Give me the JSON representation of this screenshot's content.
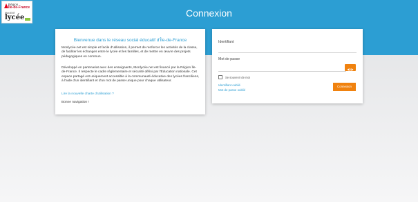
{
  "header": {
    "title": "Connexion",
    "background_color": "#2c9ed3"
  },
  "logo": {
    "line1": "Région",
    "line2": "Île-de-France",
    "line3": "Mon ENT",
    "line4": "lycée"
  },
  "info_card": {
    "welcome": "Bienvenue dans le réseau social éducatif d'Île-de-France",
    "paragraph1": "Monlycée.net est simple et facile d'utilisation, il permet de renforcer les activités de la classe, de faciliter les échanges entre le lycée et les familles, et de mettre en œuvre des projets pédagogiques en commun.",
    "paragraph2": "Développé en partenariat avec des enseignants, Monlycée.net est financé par la Région Île-de-France. Il respecte le cadre réglementaire et sécurité défini par l'Éducation nationale. Cet espace partagé est uniquement accessible à la communauté éducative des lycées franciliens, à l'aide d'un identifiant et d'un mot de passe unique pour chaque utilisateur.",
    "charter_link": "Lire la nouvelle charte d'utilisation ?",
    "closing": "Bonne navigation !"
  },
  "login_card": {
    "identifier_label": "Identifiant",
    "identifier_value": "",
    "password_label": "Mot de passe",
    "password_value": "",
    "show_password_icon": "eye-icon",
    "remember_label": "Se souvenir de moi",
    "remember_checked": false,
    "forgot_identifier": "Identifiant oublié",
    "forgot_password": "Mot de passe oublié",
    "submit_label": "Connexion",
    "accent_color": "#f0820f"
  }
}
